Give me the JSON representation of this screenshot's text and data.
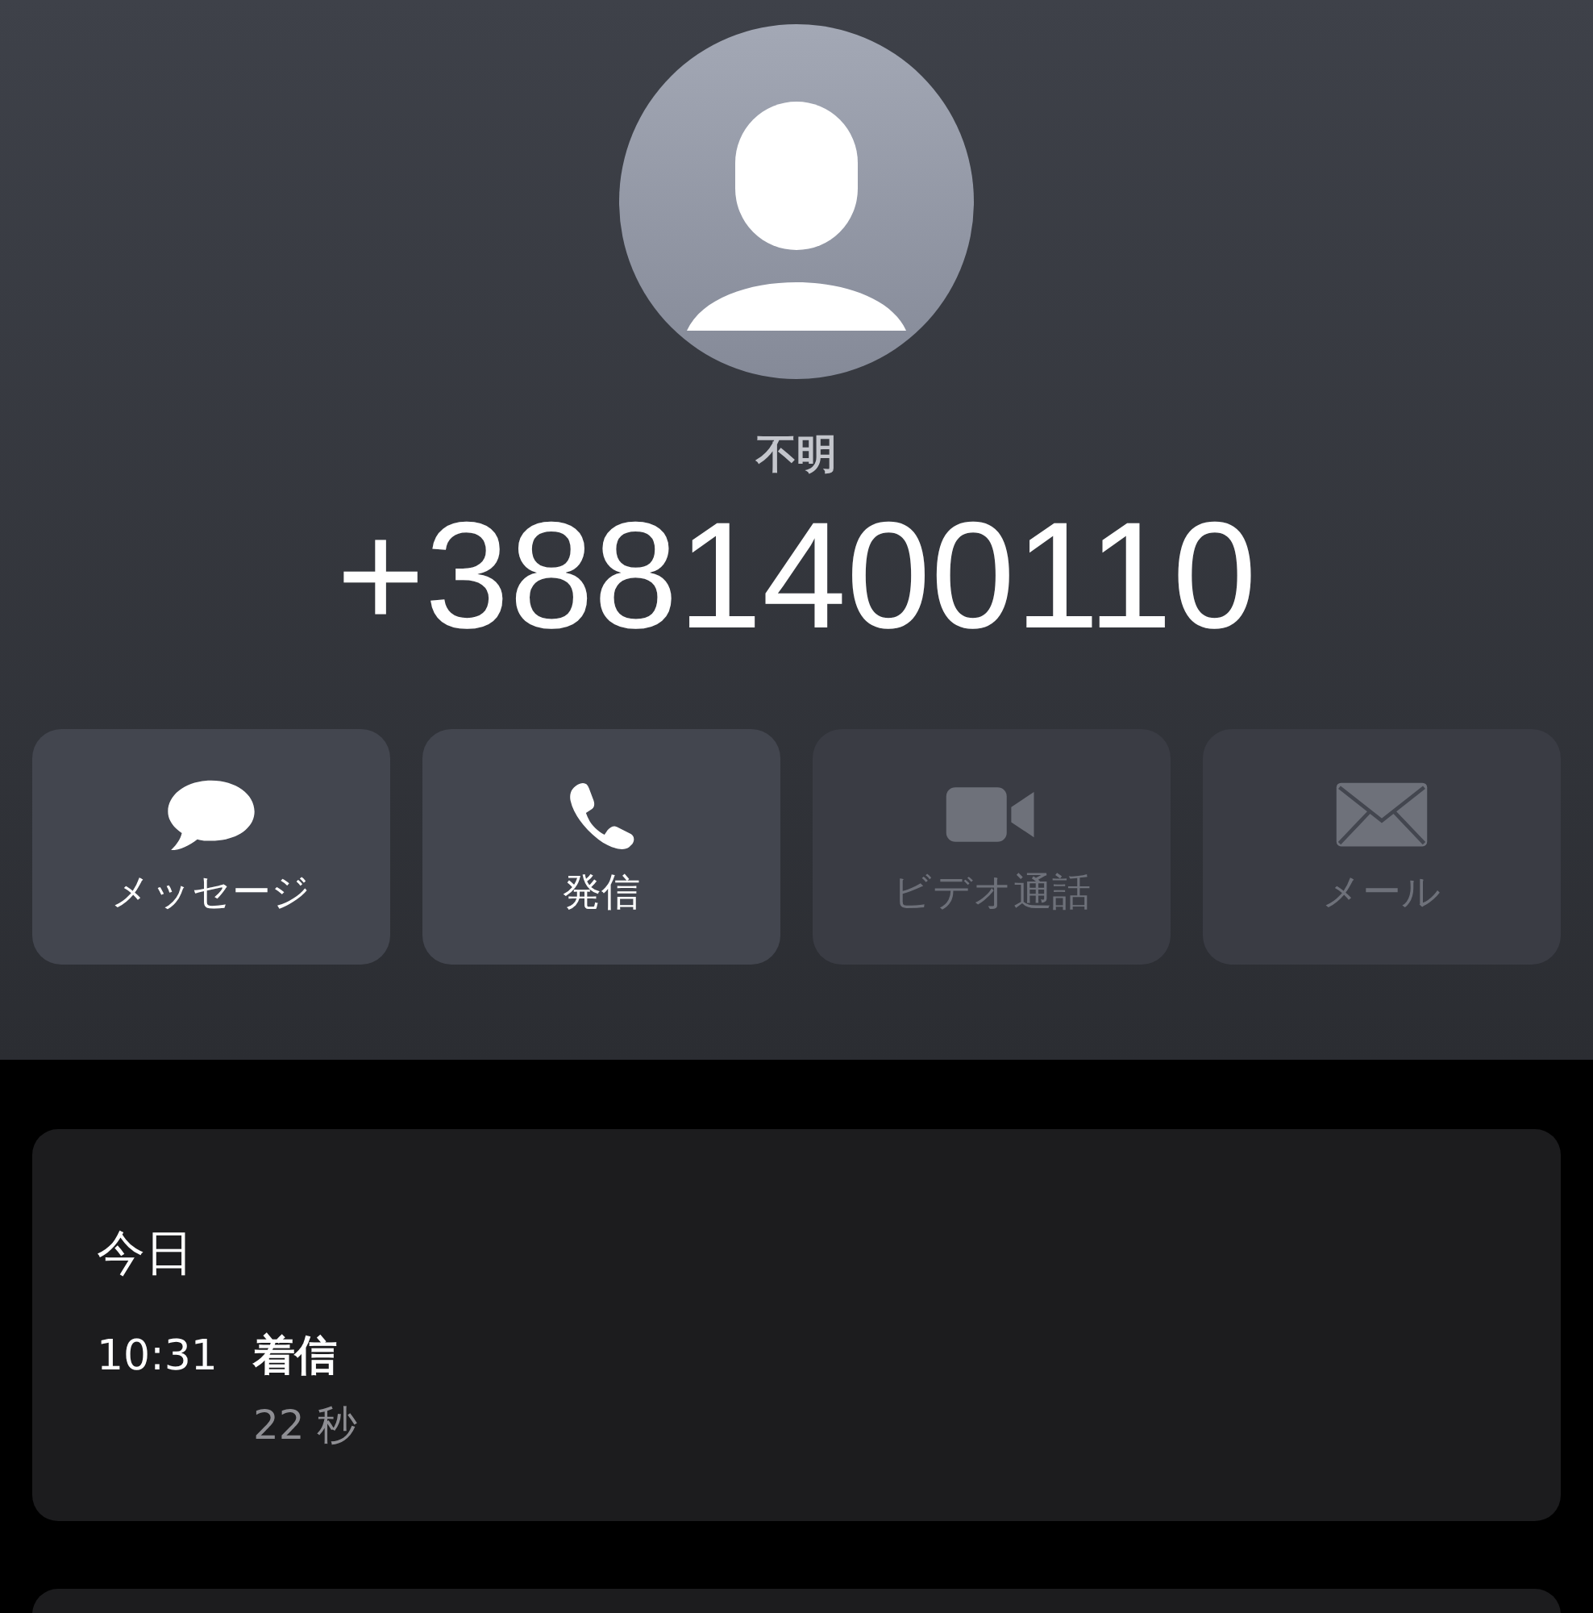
{
  "contact": {
    "label": "不明",
    "number": "+3881400110"
  },
  "actions": [
    {
      "label": "メッセージ",
      "kind": "message",
      "disabled": false
    },
    {
      "label": "発信",
      "kind": "phone",
      "disabled": false
    },
    {
      "label": "ビデオ通話",
      "kind": "video",
      "disabled": true
    },
    {
      "label": "メール",
      "kind": "mail",
      "disabled": true
    }
  ],
  "history": {
    "title": "今日",
    "entries": [
      {
        "time": "10:31",
        "type": "着信",
        "duration": "22 秒"
      }
    ]
  }
}
